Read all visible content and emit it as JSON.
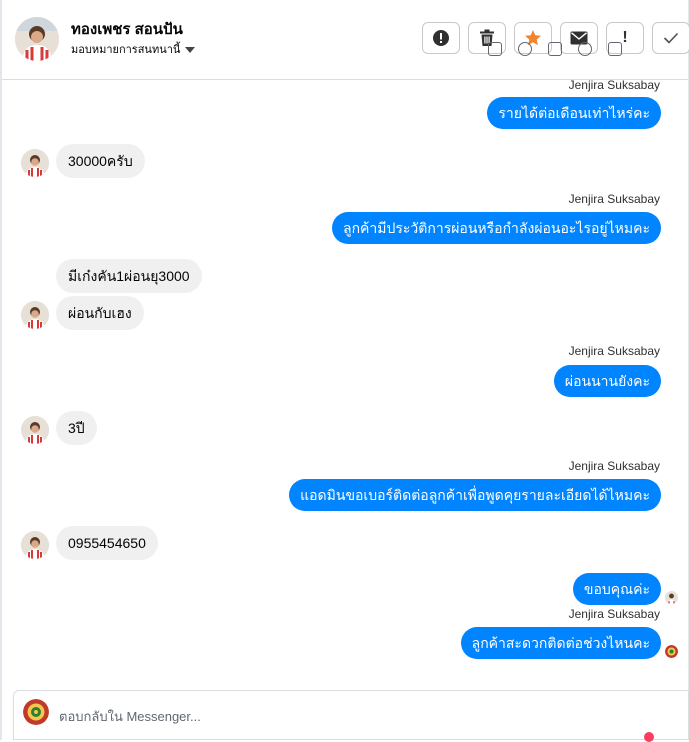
{
  "header": {
    "contact_name": "ทองเพชร สอนปัน",
    "assign_label": "มอบหมายการสนทนานี้"
  },
  "actions": [
    {
      "name": "spam-button",
      "icon": "alert-circle-icon"
    },
    {
      "name": "delete-button",
      "icon": "trash-icon"
    },
    {
      "name": "star-button",
      "icon": "star-icon"
    },
    {
      "name": "mark-unread-button",
      "icon": "envelope-icon"
    },
    {
      "name": "important-button",
      "icon": "exclamation-icon",
      "glyph": "!"
    },
    {
      "name": "done-button",
      "icon": "checkmark-icon"
    }
  ],
  "colors": {
    "outgoing_bubble": "#0084ff",
    "incoming_bubble": "#f0f0f0",
    "star": "#f0852d"
  },
  "messages": [
    {
      "dir": "out",
      "sender": "Jenjira Suksabay",
      "text": "รายได้ต่อเดือนเท่าไหร่คะ"
    },
    {
      "dir": "in",
      "text": "30000ครับ"
    },
    {
      "dir": "out",
      "sender": "Jenjira Suksabay",
      "text": "ลูกค้ามีประวัติการผ่อนหรือกำลังผ่อนอะไรอยู่ไหมคะ"
    },
    {
      "dir": "in",
      "text": "มีเก๋งคัน1ผ่อนยุ3000"
    },
    {
      "dir": "in",
      "text": "ผ่อนกับเฮง"
    },
    {
      "dir": "out",
      "sender": "Jenjira Suksabay",
      "text": "ผ่อนนานยังคะ"
    },
    {
      "dir": "in",
      "text": "3ปี"
    },
    {
      "dir": "out",
      "sender": "Jenjira Suksabay",
      "text": "แอดมินขอเบอร์ติดต่อลูกค้าเพื่อพูดคุยรายละเอียดได้ไหมคะ"
    },
    {
      "dir": "in",
      "text": "0955454650"
    },
    {
      "dir": "out",
      "text": "ขอบคุณค่ะ"
    },
    {
      "dir": "out",
      "sender": "Jenjira Suksabay",
      "text": "ลูกค้าสะดวกติดต่อช่วงไหนคะ"
    }
  ],
  "composer": {
    "placeholder": "ตอบกลับใน Messenger..."
  }
}
